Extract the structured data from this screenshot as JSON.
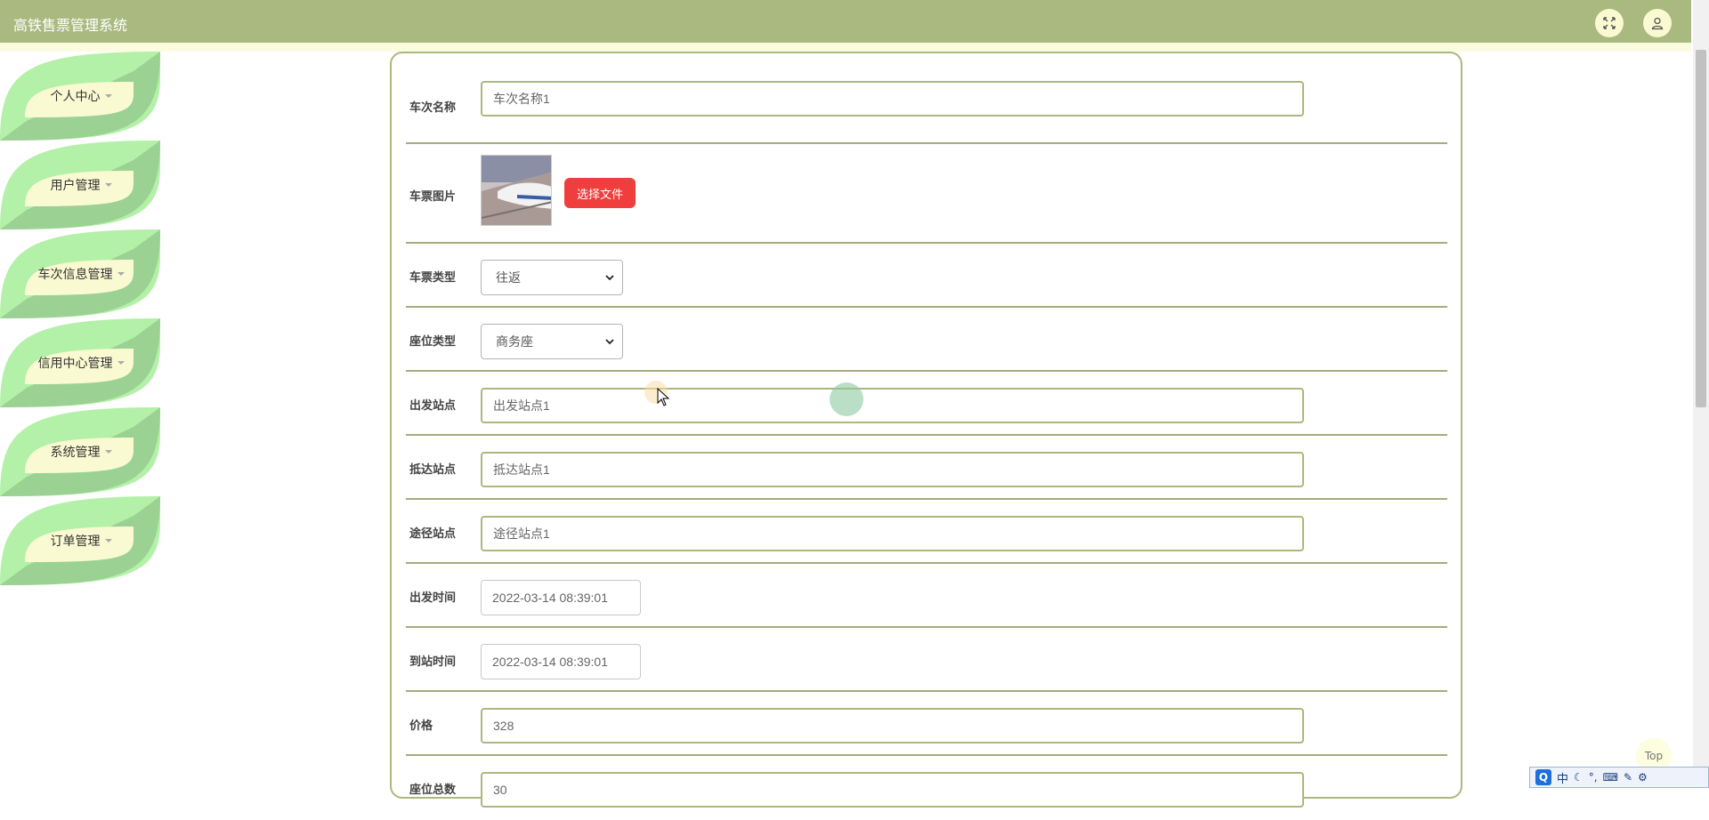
{
  "header": {
    "title": "高铁售票管理系统",
    "fullscreen_icon": "fullscreen-icon",
    "user_icon": "user-icon"
  },
  "sidebar": {
    "items": [
      {
        "label": "个人中心"
      },
      {
        "label": "用户管理"
      },
      {
        "label": "车次信息管理"
      },
      {
        "label": "信用中心管理"
      },
      {
        "label": "系统管理"
      },
      {
        "label": "订单管理"
      }
    ]
  },
  "form": {
    "train_name": {
      "label": "车次名称",
      "value": "车次名称1"
    },
    "ticket_image": {
      "label": "车票图片",
      "button": "选择文件"
    },
    "ticket_type": {
      "label": "车票类型",
      "value": "往返"
    },
    "seat_type": {
      "label": "座位类型",
      "value": "商务座"
    },
    "departure_station": {
      "label": "出发站点",
      "value": "出发站点1"
    },
    "arrival_station": {
      "label": "抵达站点",
      "value": "抵达站点1"
    },
    "via_station": {
      "label": "途径站点",
      "value": "途径站点1"
    },
    "departure_time": {
      "label": "出发时间",
      "value": "2022-03-14 08:39:01"
    },
    "arrival_time": {
      "label": "到站时间",
      "value": "2022-03-14 08:39:01"
    },
    "price": {
      "label": "价格",
      "value": "328"
    },
    "total_seats": {
      "label": "座位总数",
      "value": "30"
    }
  },
  "back_to_top": "Top",
  "ime": {
    "logo": "Q",
    "mode": "中"
  },
  "colors": {
    "header": "#aab97f",
    "accent_button": "#f03d3d",
    "menu_outer": "#b3f0a8",
    "menu_inner": "#fafad2"
  }
}
